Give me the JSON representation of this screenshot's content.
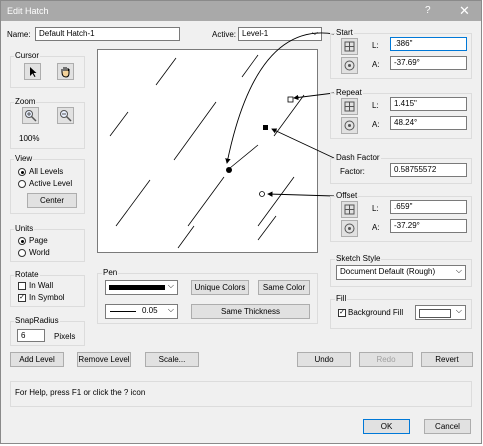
{
  "window": {
    "title": "Edit Hatch",
    "help_glyph": "?",
    "close_glyph": "✕"
  },
  "name": {
    "label": "Name:",
    "value": "Default Hatch-1"
  },
  "active": {
    "label": "Active:",
    "value": "Level-1"
  },
  "cursor": {
    "title": "Cursor",
    "arrow_icon": "arrow-cursor-icon",
    "hand_icon": "hand-cursor-icon"
  },
  "zoom": {
    "title": "Zoom",
    "percent": "100%"
  },
  "view": {
    "title": "View",
    "all_levels": "All Levels",
    "active_level": "Active Level",
    "center": "Center",
    "selected": "all_levels"
  },
  "units": {
    "title": "Units",
    "page": "Page",
    "world": "World",
    "selected": "page"
  },
  "rotate": {
    "title": "Rotate",
    "in_wall": "In Wall",
    "in_symbol": "In Symbol",
    "in_wall_checked": false,
    "in_symbol_checked": true
  },
  "snap": {
    "title": "SnapRadius",
    "value": "6",
    "unit": "Pixels"
  },
  "pen": {
    "title": "Pen",
    "weight": "0.05",
    "unique_colors": "Unique Colors",
    "same_color": "Same Color",
    "same_thickness": "Same Thickness"
  },
  "start": {
    "title": "Start",
    "l_label": "L:",
    "l_value": ".386\"",
    "a_label": "A:",
    "a_value": "-37.69°"
  },
  "repeat": {
    "title": "Repeat",
    "l_label": "L:",
    "l_value": "1.415\"",
    "a_label": "A:",
    "a_value": "48.24°"
  },
  "dash": {
    "title": "Dash Factor",
    "label": "Factor:",
    "value": "0.58755572"
  },
  "offset": {
    "title": "Offset",
    "l_label": "L:",
    "l_value": ".659\"",
    "a_label": "A:",
    "a_value": "-37.29°"
  },
  "sketch": {
    "title": "Sketch Style",
    "value": "Document Default (Rough)"
  },
  "fill": {
    "title": "Fill",
    "background_fill": "Background Fill",
    "checked": true
  },
  "actions": {
    "add_level": "Add Level",
    "remove_level": "Remove Level",
    "scale": "Scale...",
    "undo": "Undo",
    "redo": "Redo",
    "revert": "Revert"
  },
  "help": {
    "text": "For Help, press F1 or click the ? icon"
  },
  "footer": {
    "ok": "OK",
    "cancel": "Cancel"
  },
  "colors": {
    "titlebar": "#a9a9a9",
    "dialog_bg": "#f0f0f0",
    "focus_border": "#0078d7"
  }
}
